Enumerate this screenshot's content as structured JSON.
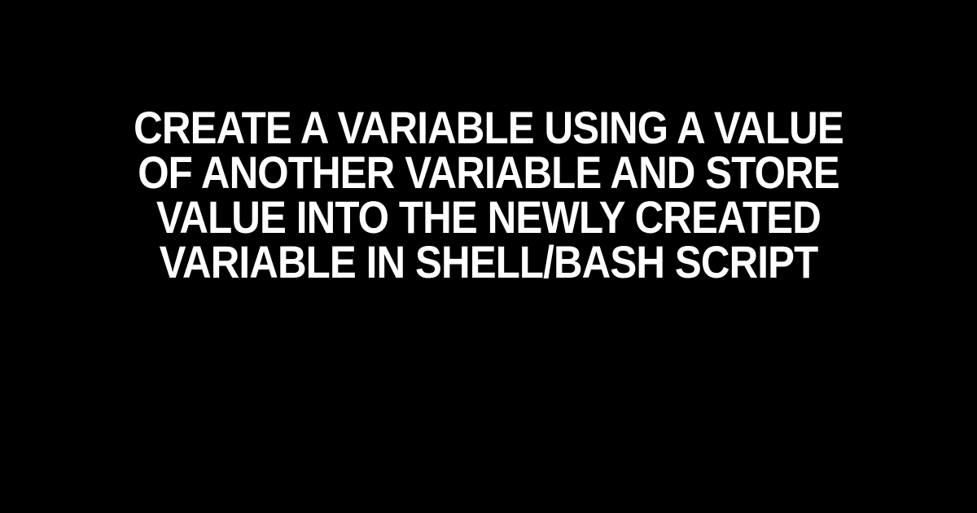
{
  "heading": "Create a Variable Using a Value of Another Variable and Store Value into the Newly Created Variable in Shell/Bash Script"
}
